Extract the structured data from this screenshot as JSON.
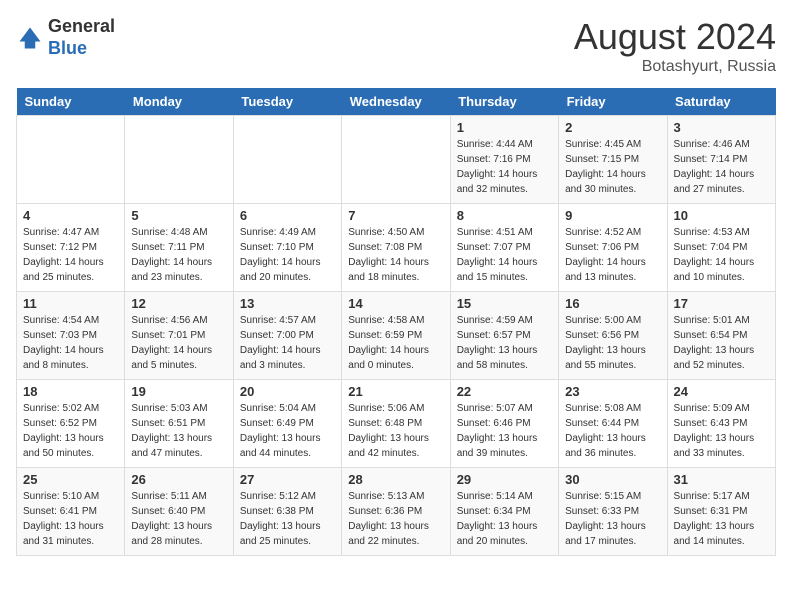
{
  "header": {
    "logo_general": "General",
    "logo_blue": "Blue",
    "month_year": "August 2024",
    "location": "Botashyurt, Russia"
  },
  "days_of_week": [
    "Sunday",
    "Monday",
    "Tuesday",
    "Wednesday",
    "Thursday",
    "Friday",
    "Saturday"
  ],
  "weeks": [
    [
      {
        "day": "",
        "detail": ""
      },
      {
        "day": "",
        "detail": ""
      },
      {
        "day": "",
        "detail": ""
      },
      {
        "day": "",
        "detail": ""
      },
      {
        "day": "1",
        "detail": "Sunrise: 4:44 AM\nSunset: 7:16 PM\nDaylight: 14 hours\nand 32 minutes."
      },
      {
        "day": "2",
        "detail": "Sunrise: 4:45 AM\nSunset: 7:15 PM\nDaylight: 14 hours\nand 30 minutes."
      },
      {
        "day": "3",
        "detail": "Sunrise: 4:46 AM\nSunset: 7:14 PM\nDaylight: 14 hours\nand 27 minutes."
      }
    ],
    [
      {
        "day": "4",
        "detail": "Sunrise: 4:47 AM\nSunset: 7:12 PM\nDaylight: 14 hours\nand 25 minutes."
      },
      {
        "day": "5",
        "detail": "Sunrise: 4:48 AM\nSunset: 7:11 PM\nDaylight: 14 hours\nand 23 minutes."
      },
      {
        "day": "6",
        "detail": "Sunrise: 4:49 AM\nSunset: 7:10 PM\nDaylight: 14 hours\nand 20 minutes."
      },
      {
        "day": "7",
        "detail": "Sunrise: 4:50 AM\nSunset: 7:08 PM\nDaylight: 14 hours\nand 18 minutes."
      },
      {
        "day": "8",
        "detail": "Sunrise: 4:51 AM\nSunset: 7:07 PM\nDaylight: 14 hours\nand 15 minutes."
      },
      {
        "day": "9",
        "detail": "Sunrise: 4:52 AM\nSunset: 7:06 PM\nDaylight: 14 hours\nand 13 minutes."
      },
      {
        "day": "10",
        "detail": "Sunrise: 4:53 AM\nSunset: 7:04 PM\nDaylight: 14 hours\nand 10 minutes."
      }
    ],
    [
      {
        "day": "11",
        "detail": "Sunrise: 4:54 AM\nSunset: 7:03 PM\nDaylight: 14 hours\nand 8 minutes."
      },
      {
        "day": "12",
        "detail": "Sunrise: 4:56 AM\nSunset: 7:01 PM\nDaylight: 14 hours\nand 5 minutes."
      },
      {
        "day": "13",
        "detail": "Sunrise: 4:57 AM\nSunset: 7:00 PM\nDaylight: 14 hours\nand 3 minutes."
      },
      {
        "day": "14",
        "detail": "Sunrise: 4:58 AM\nSunset: 6:59 PM\nDaylight: 14 hours\nand 0 minutes."
      },
      {
        "day": "15",
        "detail": "Sunrise: 4:59 AM\nSunset: 6:57 PM\nDaylight: 13 hours\nand 58 minutes."
      },
      {
        "day": "16",
        "detail": "Sunrise: 5:00 AM\nSunset: 6:56 PM\nDaylight: 13 hours\nand 55 minutes."
      },
      {
        "day": "17",
        "detail": "Sunrise: 5:01 AM\nSunset: 6:54 PM\nDaylight: 13 hours\nand 52 minutes."
      }
    ],
    [
      {
        "day": "18",
        "detail": "Sunrise: 5:02 AM\nSunset: 6:52 PM\nDaylight: 13 hours\nand 50 minutes."
      },
      {
        "day": "19",
        "detail": "Sunrise: 5:03 AM\nSunset: 6:51 PM\nDaylight: 13 hours\nand 47 minutes."
      },
      {
        "day": "20",
        "detail": "Sunrise: 5:04 AM\nSunset: 6:49 PM\nDaylight: 13 hours\nand 44 minutes."
      },
      {
        "day": "21",
        "detail": "Sunrise: 5:06 AM\nSunset: 6:48 PM\nDaylight: 13 hours\nand 42 minutes."
      },
      {
        "day": "22",
        "detail": "Sunrise: 5:07 AM\nSunset: 6:46 PM\nDaylight: 13 hours\nand 39 minutes."
      },
      {
        "day": "23",
        "detail": "Sunrise: 5:08 AM\nSunset: 6:44 PM\nDaylight: 13 hours\nand 36 minutes."
      },
      {
        "day": "24",
        "detail": "Sunrise: 5:09 AM\nSunset: 6:43 PM\nDaylight: 13 hours\nand 33 minutes."
      }
    ],
    [
      {
        "day": "25",
        "detail": "Sunrise: 5:10 AM\nSunset: 6:41 PM\nDaylight: 13 hours\nand 31 minutes."
      },
      {
        "day": "26",
        "detail": "Sunrise: 5:11 AM\nSunset: 6:40 PM\nDaylight: 13 hours\nand 28 minutes."
      },
      {
        "day": "27",
        "detail": "Sunrise: 5:12 AM\nSunset: 6:38 PM\nDaylight: 13 hours\nand 25 minutes."
      },
      {
        "day": "28",
        "detail": "Sunrise: 5:13 AM\nSunset: 6:36 PM\nDaylight: 13 hours\nand 22 minutes."
      },
      {
        "day": "29",
        "detail": "Sunrise: 5:14 AM\nSunset: 6:34 PM\nDaylight: 13 hours\nand 20 minutes."
      },
      {
        "day": "30",
        "detail": "Sunrise: 5:15 AM\nSunset: 6:33 PM\nDaylight: 13 hours\nand 17 minutes."
      },
      {
        "day": "31",
        "detail": "Sunrise: 5:17 AM\nSunset: 6:31 PM\nDaylight: 13 hours\nand 14 minutes."
      }
    ]
  ]
}
